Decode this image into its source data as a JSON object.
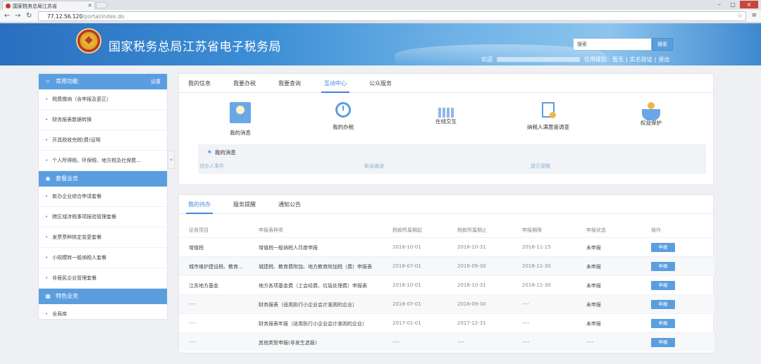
{
  "browser": {
    "tab_title": "国家税务总局江苏省",
    "url_host": "77.12.56.120",
    "url_path": "/portal/index.do"
  },
  "header": {
    "site_title": "国家税务总局江苏省电子税务局",
    "search_placeholder": "搜索",
    "search_button": "搜索",
    "welcome_label": "欢迎",
    "credit_label": "信用级别：暂无",
    "verify_link": "实名验证",
    "logout_link": "退出"
  },
  "sidebar": {
    "sections": [
      {
        "title": "常用功能",
        "action": "设置",
        "items": [
          "税费缴纳（含申报及更正）",
          "财务报表数据转换",
          "开具税收完税(费)证明",
          "个人所得税、环保税、地方税及社保费..."
        ]
      },
      {
        "title": "套餐业务",
        "items": [
          "新办企业综合申请套餐",
          "跨区域涉税事项报验管理套餐",
          "发票票种核定变更套餐",
          "小规模转一般纳税人套餐",
          "非居民企业管理套餐"
        ]
      },
      {
        "title": "特色业务",
        "items": [
          "全局库"
        ]
      }
    ],
    "collapse_glyph": "«"
  },
  "top_panel": {
    "tabs": [
      "我的信息",
      "我要办税",
      "我要查询",
      "互动中心",
      "公众服务"
    ],
    "active_tab": 3,
    "features": [
      {
        "label": "我的消息",
        "icon": "user-icon"
      },
      {
        "label": "我的办税",
        "icon": "clock-icon"
      },
      {
        "label": "在线交互",
        "icon": "chat-icon"
      },
      {
        "label": "纳税人满意度调查",
        "icon": "survey-icon"
      },
      {
        "label": "权益保护",
        "icon": "hand-icon"
      }
    ],
    "message_box": {
      "title": "我的消息",
      "links": [
        "待办人事件",
        "新闻速递",
        "提示提醒"
      ]
    }
  },
  "bottom_panel": {
    "tabs": [
      "我的待办",
      "服务提醒",
      "通知公告"
    ],
    "active_tab": 0,
    "columns": [
      "征收项目",
      "申报表种类",
      "税款所属期起",
      "税款所属期止",
      "申报期限",
      "申报状态",
      "操作"
    ],
    "rows": [
      [
        "增值税",
        "增值税一般纳税人月度申报",
        "2018-10-01",
        "2018-10-31",
        "2018-11-15",
        "未申报",
        "申报"
      ],
      [
        "城市维护建设税、教育...",
        "城建税、教育费附加、地方教育附加税（费）申报表",
        "2018-07-01",
        "2018-09-30",
        "2018-11-30",
        "未申报",
        "申报"
      ],
      [
        "江苏地方基金",
        "地方各项基金费（工会经费、垃圾处理费）申报表",
        "2018-10-01",
        "2018-10-31",
        "2018-11-30",
        "未申报",
        "申报"
      ],
      [
        "----",
        "财务报表（适用执行小企业会计准则的企业）",
        "2018-07-01",
        "2018-09-30",
        "----",
        "未申报",
        "申报"
      ],
      [
        "----",
        "财务报表年报（适用执行小企业会计准则的企业）",
        "2017-01-01",
        "2017-12-31",
        "----",
        "未申报",
        "申报"
      ],
      [
        "----",
        "其他类型申报(非发生选报)",
        "----",
        "----",
        "----",
        "----",
        "申报"
      ]
    ]
  },
  "colors": {
    "accent": "#3f86d6",
    "sidebar_header": "#5b9ee0",
    "close_button": "#c9463d"
  }
}
